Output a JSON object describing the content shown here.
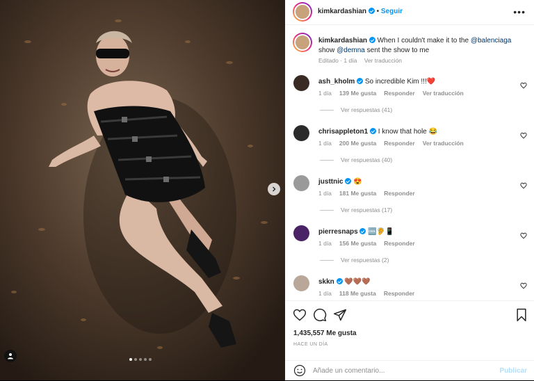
{
  "post": {
    "author": "kimkardashian",
    "follow_label": "Seguir",
    "more_label": "•••",
    "media": {
      "carousel_dots": 5,
      "active_dot": 0
    }
  },
  "caption": {
    "author": "kimkardashian",
    "text_before": "When I couldn't make it to the ",
    "mention_1": "@balenciaga",
    "text_middle": " show ",
    "mention_2": "@demna",
    "text_after": " sent the show to me",
    "edited": "Editado",
    "age": "1 día",
    "translate": "Ver traducción"
  },
  "comments": [
    {
      "user": "ash_kholm",
      "verified": true,
      "text": "So incredible Kim !!!❤️",
      "age": "1 día",
      "likes": "139 Me gusta",
      "reply": "Responder",
      "translate": "Ver traducción",
      "replies": "Ver respuestas (41)",
      "avatar_color": "#3a2a24"
    },
    {
      "user": "chrisappleton1",
      "verified": true,
      "text": "I know that hole 😂",
      "age": "1 día",
      "likes": "200 Me gusta",
      "reply": "Responder",
      "translate": "Ver traducción",
      "replies": "Ver respuestas (40)",
      "avatar_color": "#2b2b2b"
    },
    {
      "user": "justtnic",
      "verified": true,
      "text": "😍",
      "age": "1 día",
      "likes": "181 Me gusta",
      "reply": "Responder",
      "translate": "",
      "replies": "Ver respuestas (17)",
      "avatar_color": "#9a9a9a"
    },
    {
      "user": "pierresnaps",
      "verified": true,
      "text": "🆒🦻📱",
      "age": "1 día",
      "likes": "156 Me gusta",
      "reply": "Responder",
      "translate": "",
      "replies": "Ver respuestas (2)",
      "avatar_color": "#4a2366"
    },
    {
      "user": "skkn",
      "verified": true,
      "text": "🤎🤎🤎",
      "age": "1 día",
      "likes": "118 Me gusta",
      "reply": "Responder",
      "translate": "",
      "replies": "",
      "avatar_color": "#b9a89a"
    }
  ],
  "footer": {
    "likes": "1,435,557 Me gusta",
    "posted_ago": "HACE UN DÍA",
    "comment_placeholder": "Añade un comentario...",
    "publish_label": "Publicar"
  },
  "colors": {
    "accent": "#0095f6",
    "text": "#262626",
    "muted": "#8e8e8e",
    "publish_disabled": "#b2dffc",
    "heart_red": "#ed4956"
  },
  "icons": [
    "heart-icon",
    "comment-icon",
    "share-icon",
    "bookmark-icon",
    "emoji-icon",
    "chevron-right-icon",
    "user-tag-icon",
    "more-icon",
    "verified-badge-icon"
  ]
}
